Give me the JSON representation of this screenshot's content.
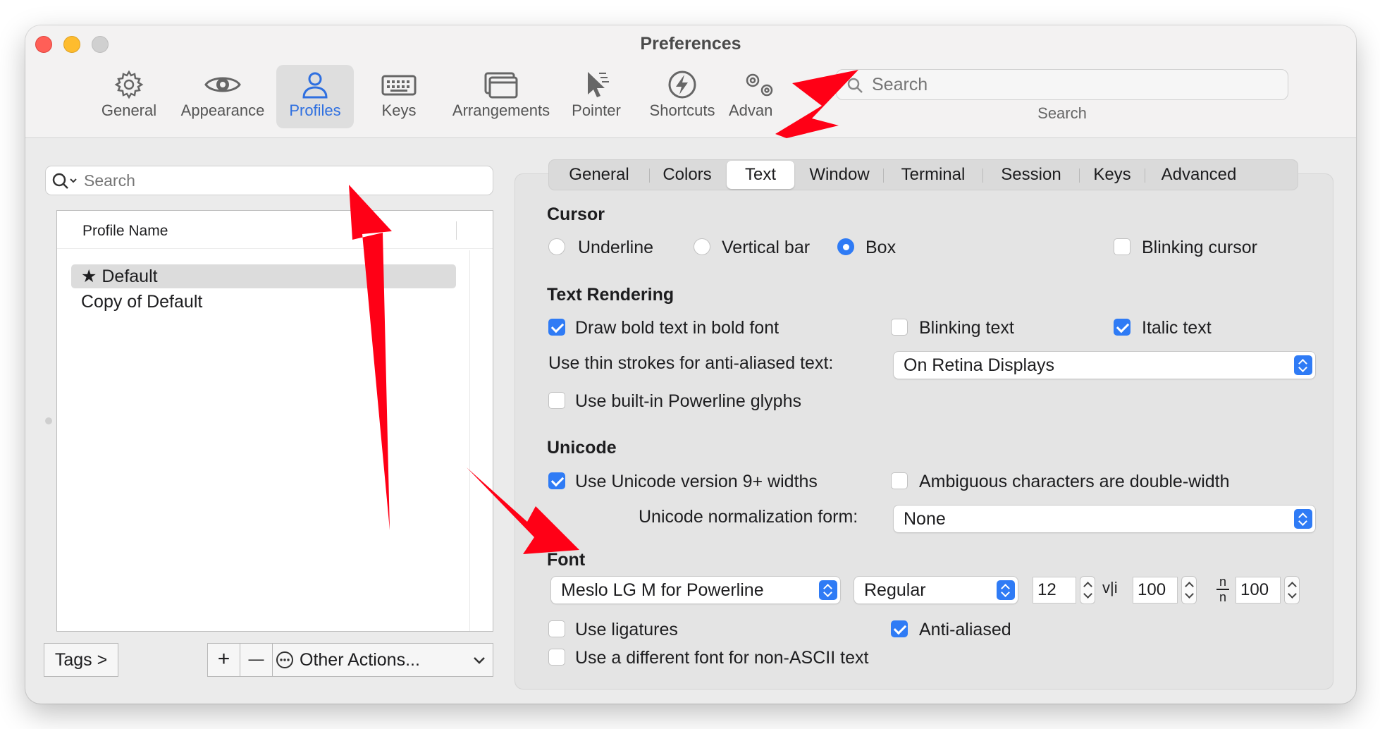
{
  "window": {
    "title": "Preferences"
  },
  "toolbar": {
    "items": [
      {
        "label": "General",
        "icon": "gear-icon"
      },
      {
        "label": "Appearance",
        "icon": "eye-icon"
      },
      {
        "label": "Profiles",
        "icon": "person-icon"
      },
      {
        "label": "Keys",
        "icon": "keyboard-icon"
      },
      {
        "label": "Arrangements",
        "icon": "windows-icon"
      },
      {
        "label": "Pointer",
        "icon": "pointer-icon"
      },
      {
        "label": "Shortcuts",
        "icon": "bolt-icon"
      },
      {
        "label": "Advan",
        "icon": "gears-icon"
      }
    ],
    "selected": "Profiles",
    "search": {
      "placeholder": "Search",
      "caption": "Search"
    }
  },
  "sidebar": {
    "search_placeholder": "Search",
    "column_header": "Profile Name",
    "profiles": [
      {
        "star": "★",
        "name": "Default"
      },
      {
        "name": "Copy of Default"
      }
    ],
    "tags_button": "Tags >",
    "add_label": "+",
    "remove_label": "—",
    "other_actions": "Other Actions..."
  },
  "tabs": [
    "General",
    "Colors",
    "Text",
    "Window",
    "Terminal",
    "Session",
    "Keys",
    "Advanced"
  ],
  "selected_tab": "Text",
  "cursor": {
    "heading": "Cursor",
    "options": [
      "Underline",
      "Vertical bar",
      "Box"
    ],
    "selected": "Box",
    "blinking_label": "Blinking cursor",
    "blinking": false
  },
  "text_rendering": {
    "heading": "Text Rendering",
    "bold_label": "Draw bold text in bold font",
    "bold": true,
    "blinking_text_label": "Blinking text",
    "blinking_text": false,
    "italic_label": "Italic text",
    "italic": true,
    "thin_strokes_label": "Use thin strokes for anti-aliased text:",
    "thin_strokes_value": "On Retina Displays",
    "powerline_label": "Use built-in Powerline glyphs",
    "powerline": false
  },
  "unicode": {
    "heading": "Unicode",
    "v9_label": "Use Unicode version 9+ widths",
    "v9": true,
    "ambiguous_label": "Ambiguous characters are double-width",
    "ambiguous": false,
    "normalization_label": "Unicode normalization form:",
    "normalization_value": "None"
  },
  "font": {
    "heading": "Font",
    "family": "Meslo LG M for Powerline",
    "style": "Regular",
    "size": "12",
    "hspacing_icon": "v|i",
    "hspacing": "100",
    "vspacing_icon": "n/n",
    "vspacing_top": "n",
    "vspacing_bottom": "n",
    "vspacing": "100",
    "ligatures_label": "Use ligatures",
    "ligatures": false,
    "antialiased_label": "Anti-aliased",
    "antialiased": true,
    "nonascii_label": "Use a different font for non-ASCII text",
    "nonascii": false
  },
  "colors": {
    "accent": "#2f7bf5",
    "annotation_arrow": "#ff0016",
    "close": "#ff5f57",
    "minimize": "#febc2e",
    "zoom": "#c8c8c8"
  }
}
